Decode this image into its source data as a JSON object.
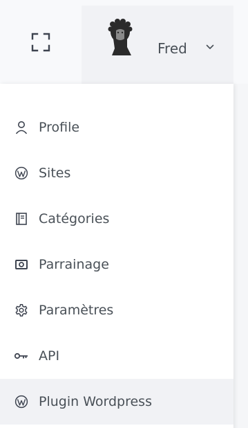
{
  "header": {
    "user_name": "Fred"
  },
  "menu": {
    "items": [
      {
        "label": "Profile",
        "icon": "user-icon"
      },
      {
        "label": "Sites",
        "icon": "wordpress-icon"
      },
      {
        "label": "Catégories",
        "icon": "book-icon"
      },
      {
        "label": "Parrainage",
        "icon": "camera-icon"
      },
      {
        "label": "Paramètres",
        "icon": "gear-icon"
      },
      {
        "label": "API",
        "icon": "key-icon"
      },
      {
        "label": "Plugin Wordpress",
        "icon": "wordpress-icon"
      }
    ]
  },
  "colors": {
    "text": "#495057",
    "header_bg": "#f8f9fb",
    "user_button_bg": "#f1f2f5",
    "active_item_bg": "#f1f2f5"
  }
}
